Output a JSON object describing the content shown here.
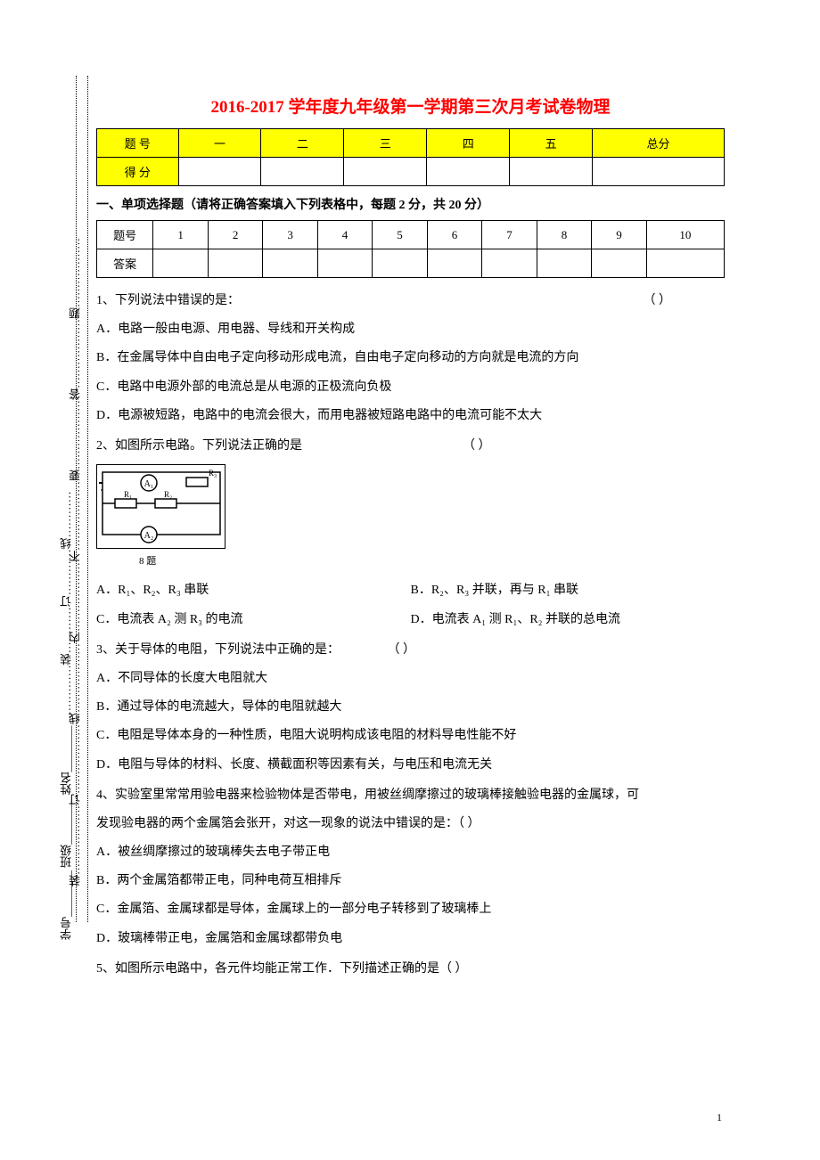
{
  "binding": {
    "outer": "装………………订………………线………………内………………不………………要………………答………………题………………",
    "inner": "学号________     班级________      姓名________     ……………装…………订…………线…………"
  },
  "title": "2016-2017 学年度九年级第一学期第三次月考试卷物理",
  "score_table": {
    "row1": [
      "题   号",
      "一",
      "二",
      "三",
      "四",
      "五",
      "总分"
    ],
    "row2_label": "得   分"
  },
  "section1": "一、单项选择题（请将正确答案填入下列表格中，每题 2 分，共 20 分）",
  "answer_table": {
    "header": [
      "题号",
      "1",
      "2",
      "3",
      "4",
      "5",
      "6",
      "7",
      "8",
      "9",
      "10"
    ],
    "row_label": "答案"
  },
  "q1": {
    "stem": "1、下列说法中错误的是：",
    "paren": "（      ）",
    "a": "A．电路一般由电源、用电器、导线和开关构成",
    "b": "B．在金属导体中自由电子定向移动形成电流，自由电子定向移动的方向就是电流的方向",
    "c": "C．电路中电源外部的电流总是从电源的正极流向负极",
    "d": "D．电源被短路，电路中的电流会很大，而用电器被短路电路中的电流可能不太大"
  },
  "q2": {
    "stem": "2、如图所示电路。下列说法正确的是",
    "paren": "（   ）",
    "diagram_label": "8 题",
    "a": "A．R₁、R₂、R₃ 串联",
    "b": "B．R₂、R₃ 并联，再与 R₁ 串联",
    "c": "C．电流表 A₂ 测 R₃ 的电流",
    "d": "D．电流表 A₁ 测 R₁、R₂ 并联的总电流"
  },
  "q3": {
    "stem": "3、关于导体的电阻，下列说法中正确的是：",
    "paren": "（      ）",
    "a": "A．不同导体的长度大电阻就大",
    "b": "B．通过导体的电流越大，导体的电阻就越大",
    "c": "C．电阻是导体本身的一种性质，电阻大说明构成该电阻的材料导电性能不好",
    "d": "D．电阻与导体的材料、长度、横截面积等因素有关，与电压和电流无关"
  },
  "q4": {
    "stem": "4、实验室里常常用验电器来检验物体是否带电，用被丝绸摩擦过的玻璃棒接触验电器的金属球，可",
    "stem2": "发现验电器的两个金属箔会张开，对这一现象的说法中错误的是：（  ）",
    "a": "A．被丝绸摩擦过的玻璃棒失去电子带正电",
    "b": "B．两个金属箔都带正电，同种电荷互相排斥",
    "c": "C．金属箔、金属球都是导体，金属球上的一部分电子转移到了玻璃棒上",
    "d": "D．玻璃棒带正电，金属箔和金属球都带负电"
  },
  "q5": {
    "stem": "5、如图所示电路中，各元件均能正常工作．下列描述正确的是（   ）"
  },
  "page_num": "1"
}
